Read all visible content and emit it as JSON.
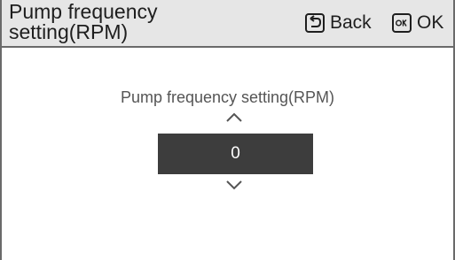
{
  "header": {
    "title": "Pump frequency setting(RPM)",
    "back_label": "Back",
    "ok_label": "OK",
    "back_icon": "return-arrow-icon",
    "ok_icon": "ok-key-icon"
  },
  "main": {
    "field_label": "Pump frequency setting(RPM)",
    "value": "0",
    "increment_icon": "chevron-up-icon",
    "decrement_icon": "chevron-down-icon"
  },
  "colors": {
    "header_bg": "#e6e6e6",
    "border": "#6a6a6a",
    "value_bg": "#3d3d3d",
    "value_text": "#ffffff",
    "label_text": "#555555"
  }
}
